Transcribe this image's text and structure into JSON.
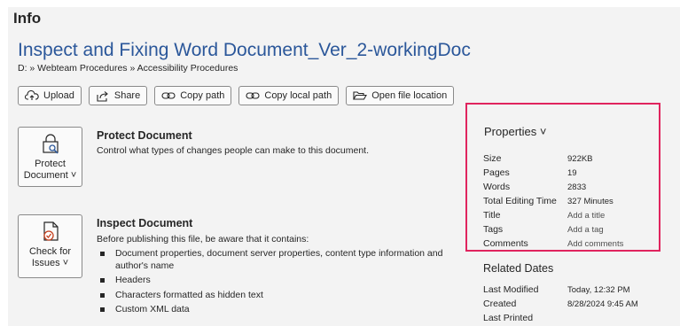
{
  "heading": "Info",
  "document": {
    "title": "Inspect and Fixing Word Document_Ver_2-workingDoc",
    "path": "D: » Webteam Procedures » Accessibility Procedures"
  },
  "buttons": {
    "upload": "Upload",
    "share": "Share",
    "copy_path": "Copy path",
    "copy_local_path": "Copy local path",
    "open_location": "Open file location"
  },
  "protect": {
    "button_line1": "Protect",
    "button_line2": "Document ˅",
    "title": "Protect Document",
    "description": "Control what types of changes people can make to this document."
  },
  "inspect": {
    "button_line1": "Check for",
    "button_line2": "Issues ˅",
    "title": "Inspect Document",
    "description": "Before publishing this file, be aware that it contains:",
    "items": [
      "Document properties, document server properties, content type information and author's name",
      "Headers",
      "Characters formatted as hidden text",
      "Custom XML data"
    ]
  },
  "properties": {
    "heading": "Properties ˅",
    "rows": [
      {
        "label": "Size",
        "value": "922KB"
      },
      {
        "label": "Pages",
        "value": "19"
      },
      {
        "label": "Words",
        "value": "2833"
      },
      {
        "label": "Total Editing Time",
        "value": "327 Minutes"
      },
      {
        "label": "Title",
        "value": "Add a title"
      },
      {
        "label": "Tags",
        "value": "Add a tag"
      },
      {
        "label": "Comments",
        "value": "Add comments"
      }
    ]
  },
  "related_dates": {
    "heading": "Related Dates",
    "rows": [
      {
        "label": "Last Modified",
        "value": "Today, 12:32 PM"
      },
      {
        "label": "Created",
        "value": "8/28/2024 9:45 AM"
      },
      {
        "label": "Last Printed",
        "value": ""
      }
    ]
  },
  "colors": {
    "title_blue": "#2b579a",
    "highlight_border": "#e0245e"
  }
}
